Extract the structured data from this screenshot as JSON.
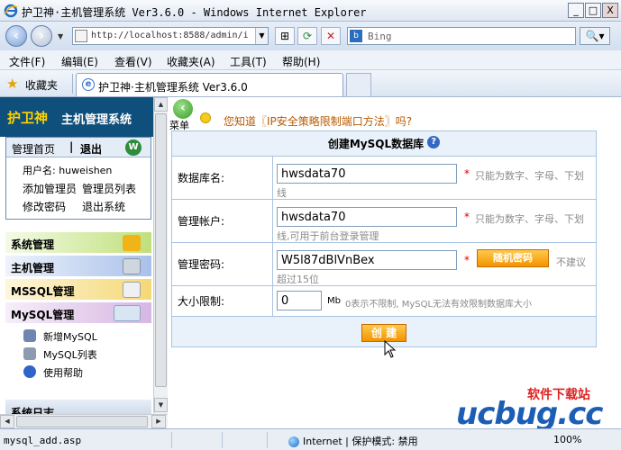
{
  "window": {
    "title": "护卫神·主机管理系统 Ver3.6.0 - Windows Internet Explorer",
    "min_label": "_",
    "max_label": "□",
    "close_label": "X"
  },
  "address": {
    "url": "http://localhost:8588/admin/ir",
    "search_placeholder": "Bing",
    "back_icon": "back-arrow-icon",
    "forward_icon": "forward-arrow-icon",
    "compat_label": "⊞",
    "refresh_label": "⟳",
    "stop_label": "✕",
    "search_btn": "🔍▾"
  },
  "menu": [
    "文件(F)",
    "编辑(E)",
    "查看(V)",
    "收藏夹(A)",
    "工具(T)",
    "帮助(H)"
  ],
  "favorites": {
    "label": "收藏夹",
    "tab_title": "护卫神·主机管理系统 Ver3.6.0"
  },
  "sidebar": {
    "brand_1": "护卫神",
    "brand_2": "主机管理系统",
    "home": "管理首页",
    "divider": "|",
    "logout": "退出",
    "username": "用户名: huweishen",
    "links": [
      "添加管理员",
      "管理员列表",
      "修改密码",
      "退出系统"
    ],
    "categories": [
      "系统管理",
      "主机管理",
      "MSSQL管理",
      "MySQL管理"
    ],
    "mysql_items": [
      "新增MySQL",
      "MySQL列表",
      "使用帮助"
    ],
    "bottom": "系统日志"
  },
  "main": {
    "menu_label": "菜单",
    "tip": "您知道〖IP安全策略限制端口方法〗吗?",
    "form_title": "创建MySQL数据库",
    "fields": {
      "dbname_label": "数据库名:",
      "dbname_value": "hwsdata70",
      "dbname_hint": "只能为数字、字母、下划",
      "dbname_hint2": "线",
      "account_label": "管理帐户:",
      "account_value": "hwsdata70",
      "account_hint": "只能为数字、字母、下划",
      "account_hint2": "线,可用于前台登录管理",
      "password_label": "管理密码:",
      "password_value": "W5l87dBlVnBex",
      "random_btn": "随机密码",
      "password_hint": "不建议",
      "password_hint2": "超过15位",
      "size_label": "大小限制:",
      "size_value": "0",
      "size_unit": "Mb",
      "size_hint": "0表示不限制, MySQL无法有效限制数据库大小"
    },
    "required_mark": "*",
    "create_btn": "创 建"
  },
  "watermark": {
    "cn": "软件下载站",
    "url": "ucbug.cc"
  },
  "status": {
    "text": "mysql_add.asp",
    "zone": "Internet | 保护模式: 禁用",
    "zoom": "100%"
  }
}
